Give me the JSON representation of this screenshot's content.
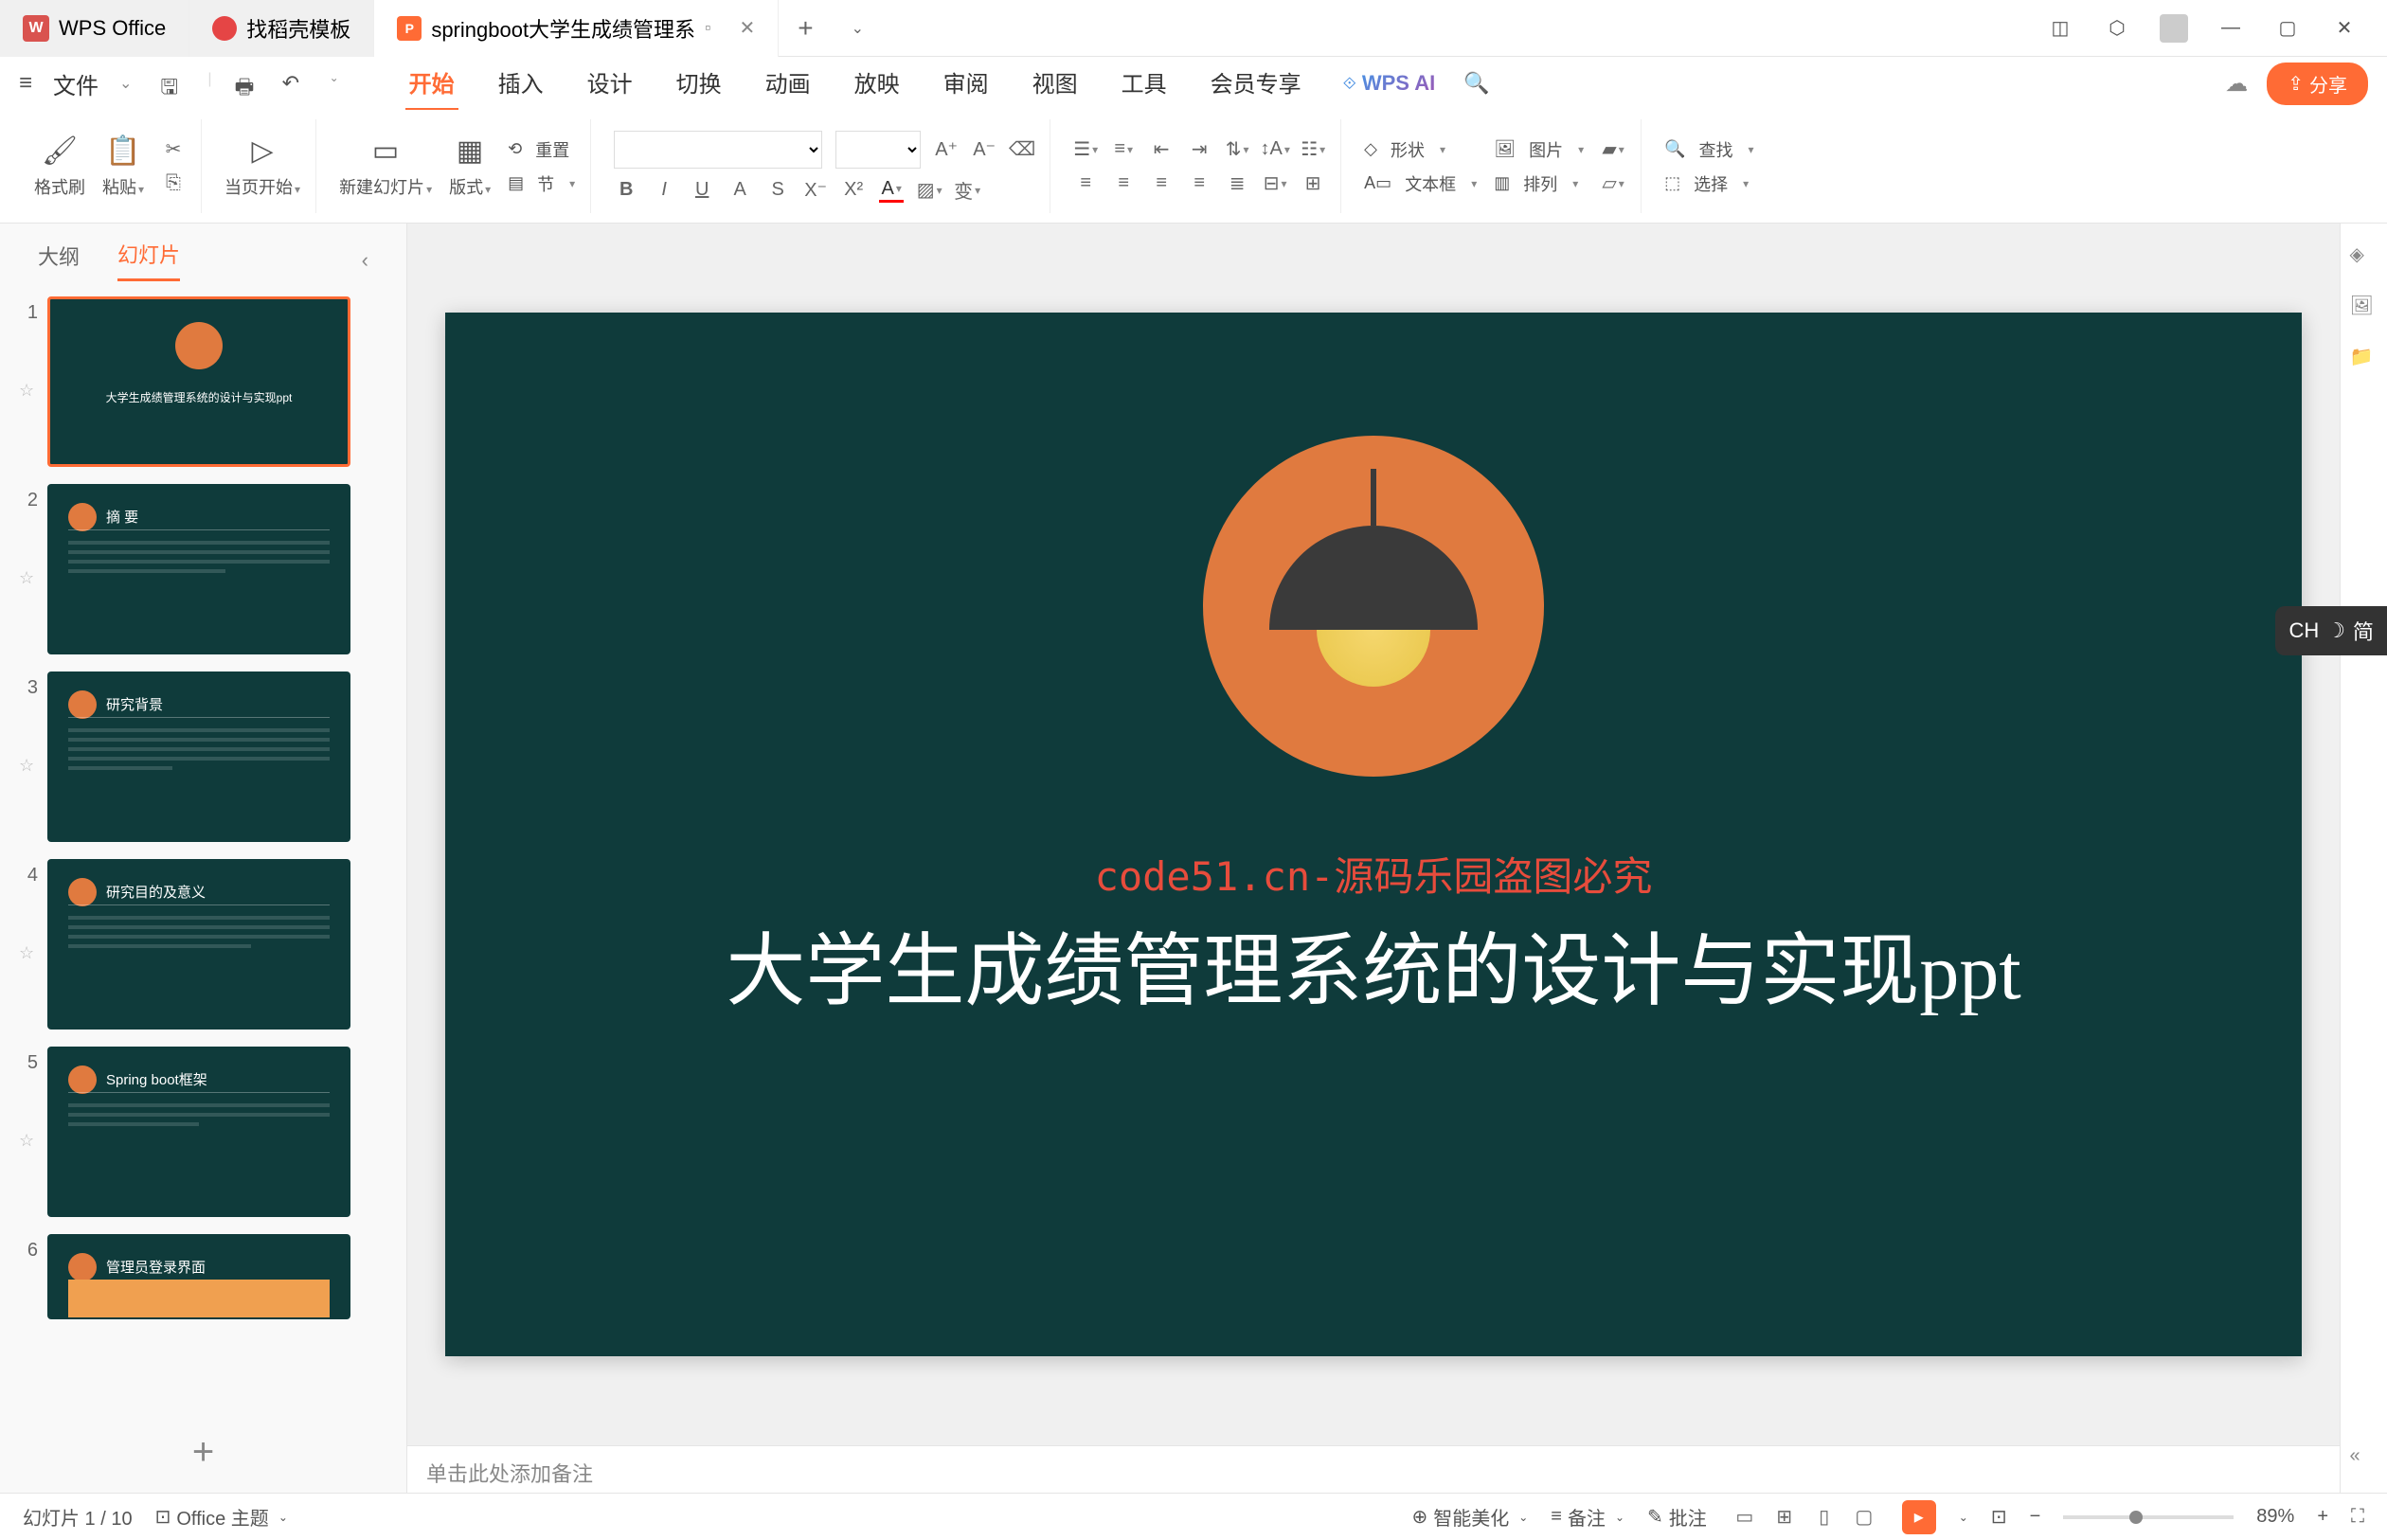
{
  "app": {
    "name": "WPS Office"
  },
  "tabs": [
    {
      "label": "WPS Office",
      "type": "app"
    },
    {
      "label": "找稻壳模板",
      "type": "doker"
    },
    {
      "label": "springboot大学生成绩管理系",
      "type": "ppt",
      "active": true,
      "closable": true
    }
  ],
  "quick_access": [
    "save",
    "print",
    "undo",
    "redo"
  ],
  "file_menu": "文件",
  "menu_tabs": [
    "开始",
    "插入",
    "设计",
    "切换",
    "动画",
    "放映",
    "审阅",
    "视图",
    "工具",
    "会员专享"
  ],
  "menu_active": "开始",
  "wps_ai_label": "WPS AI",
  "share_label": "分享",
  "ribbon": {
    "format_brush": "格式刷",
    "paste": "粘贴",
    "start_from": "当页开始",
    "new_slide": "新建幻灯片",
    "layout": "版式",
    "section": "节",
    "reset": "重置",
    "shape": "形状",
    "picture": "图片",
    "textbox": "文本框",
    "arrange": "排列",
    "find": "查找",
    "select": "选择"
  },
  "panel": {
    "outline_tab": "大纲",
    "slides_tab": "幻灯片",
    "active_tab": "幻灯片"
  },
  "thumbnails": [
    {
      "num": 1,
      "title": "大学生成绩管理系统的设计与实现ppt",
      "selected": true,
      "type": "title"
    },
    {
      "num": 2,
      "heading": "摘   要",
      "type": "content"
    },
    {
      "num": 3,
      "heading": "研究背景",
      "type": "content"
    },
    {
      "num": 4,
      "heading": "研究目的及意义",
      "type": "content"
    },
    {
      "num": 5,
      "heading": "Spring boot框架",
      "type": "content"
    },
    {
      "num": 6,
      "heading": "管理员登录界面",
      "type": "image"
    }
  ],
  "slide": {
    "title": "大学生成绩管理系统的设计与实现ppt",
    "red_watermark": "code51.cn-源码乐园盗图必究"
  },
  "notes_placeholder": "单击此处添加备注",
  "ime": {
    "lang": "CH",
    "mode": "简"
  },
  "statusbar": {
    "slide_info": "幻灯片 1 / 10",
    "theme_label": "Office 主题",
    "beautify": "智能美化",
    "notes": "备注",
    "comments": "批注",
    "zoom": "89%"
  },
  "watermark_text": "code51.cn"
}
